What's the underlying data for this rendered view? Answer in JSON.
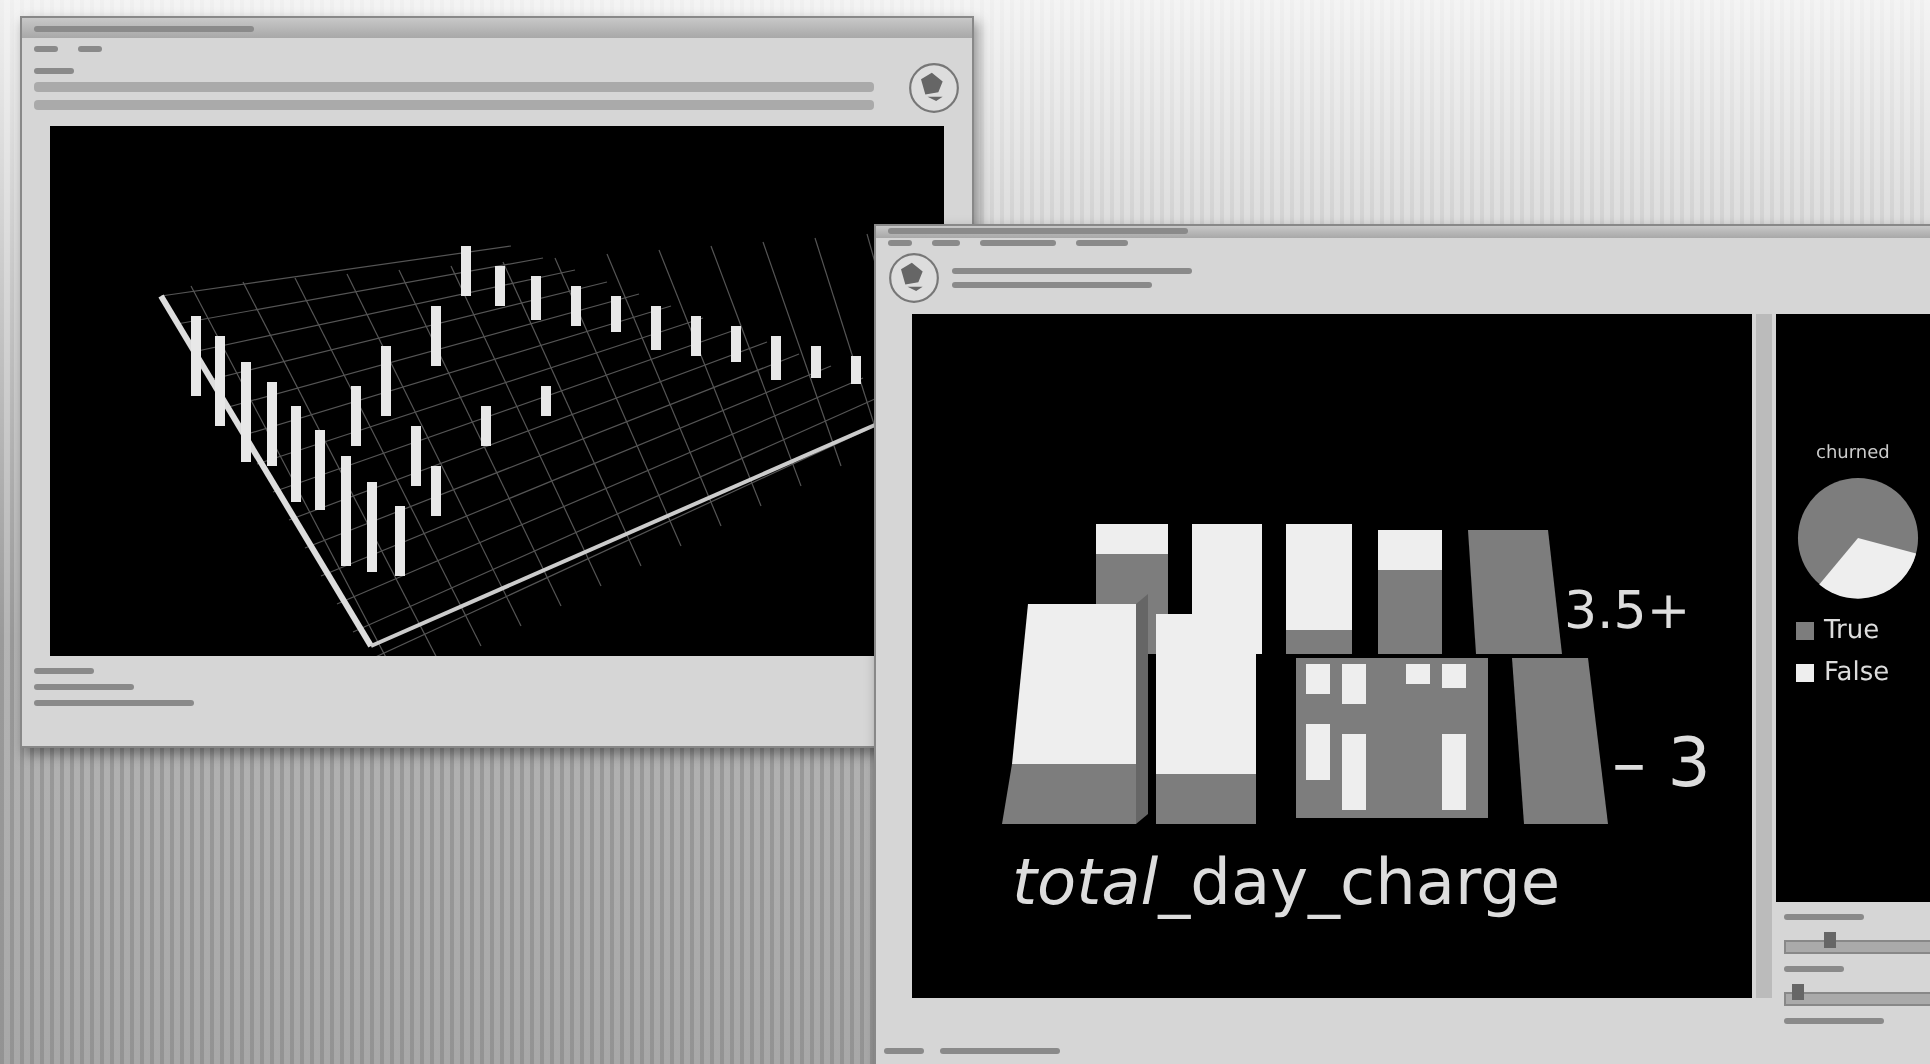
{
  "mosaic": {
    "axis_label": {
      "italic_part": "total",
      "rest": "_day_charge"
    },
    "range_labels": [
      "3.5+",
      "– 3"
    ]
  },
  "legend": {
    "title": "churned",
    "items": [
      {
        "label": "True",
        "color": "#7d7d7d"
      },
      {
        "label": "False",
        "color": "#eeeeee"
      }
    ]
  },
  "sliders": [
    {
      "level": 0.3
    },
    {
      "level": 0.08
    }
  ]
}
